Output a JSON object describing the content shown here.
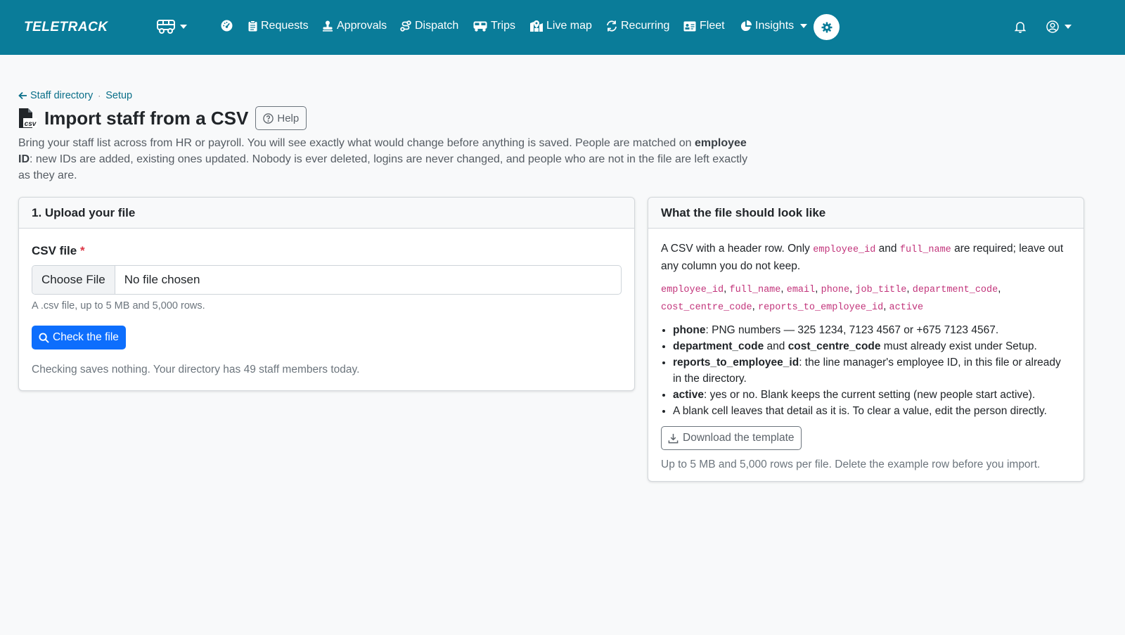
{
  "navbar": {
    "brand": "TELETRACK",
    "vehicle_menu_icon": "bus-icon",
    "items": [
      {
        "label": "",
        "icon": "dashboard-icon"
      },
      {
        "label": "Requests",
        "icon": "clipboard-icon"
      },
      {
        "label": "Approvals",
        "icon": "stamp-icon"
      },
      {
        "label": "Dispatch",
        "icon": "route-icon"
      },
      {
        "label": "Trips",
        "icon": "van-icon"
      },
      {
        "label": "Live map",
        "icon": "map-marker-icon"
      },
      {
        "label": "Recurring",
        "icon": "repeat-icon"
      },
      {
        "label": "Fleet",
        "icon": "id-card-icon"
      },
      {
        "label": "Insights",
        "icon": "pie-chart-icon"
      }
    ],
    "settings_icon": "gear-icon",
    "notifications_icon": "bell-icon",
    "user_icon": "user-circle-icon"
  },
  "breadcrumb": {
    "back": "Staff directory",
    "current": "Setup"
  },
  "page": {
    "title": "Import staff from a CSV",
    "help_label": "Help",
    "intro_before": "Bring your staff list across from HR or payroll. You will see exactly what would change before anything is saved. People are matched on ",
    "intro_bold": "employee ID",
    "intro_after": ": new IDs are added, existing ones updated. Nobody is ever deleted, logins are never changed, and people who are not in the file are left exactly as they are."
  },
  "upload_card": {
    "header": "1. Upload your file",
    "field_label": "CSV file",
    "required_mark": "*",
    "choose_label": "Choose File",
    "no_file_label": "No file chosen",
    "hint": "A .csv file, up to 5 MB and 5,000 rows.",
    "check_label": "Check the file",
    "note": "Checking saves nothing. Your directory has 49 staff members today."
  },
  "format_card": {
    "header": "What the file should look like",
    "intro_1": "A CSV with a header row. Only ",
    "req_col_1": "employee_id",
    "intro_and": " and ",
    "req_col_2": "full_name",
    "intro_2": " are required; leave out any column you do not keep.",
    "columns": [
      "employee_id",
      "full_name",
      "email",
      "phone",
      "job_title",
      "department_code",
      "cost_centre_code",
      "reports_to_employee_id",
      "active"
    ],
    "rules": [
      {
        "bold": "phone",
        "text": ": PNG numbers — 325 1234, 7123 4567 or +675 7123 4567."
      },
      {
        "bold": "department_code",
        "mid": " and ",
        "bold2": "cost_centre_code",
        "text": " must already exist under Setup."
      },
      {
        "bold": "reports_to_employee_id",
        "text": ": the line manager's employee ID, in this file or already in the directory."
      },
      {
        "bold": "active",
        "text": ": yes or no. Blank keeps the current setting (new people start active)."
      },
      {
        "bold": "",
        "text": "A blank cell leaves that detail as it is. To clear a value, edit the person directly."
      }
    ],
    "download_label": "Download the template",
    "footer": "Up to 5 MB and 5,000 rows per file. Delete the example row before you import."
  },
  "colors": {
    "navbar_bg": "#0a7c99",
    "primary": "#0d6efd",
    "code": "#c2347b",
    "required": "#dc3545"
  }
}
